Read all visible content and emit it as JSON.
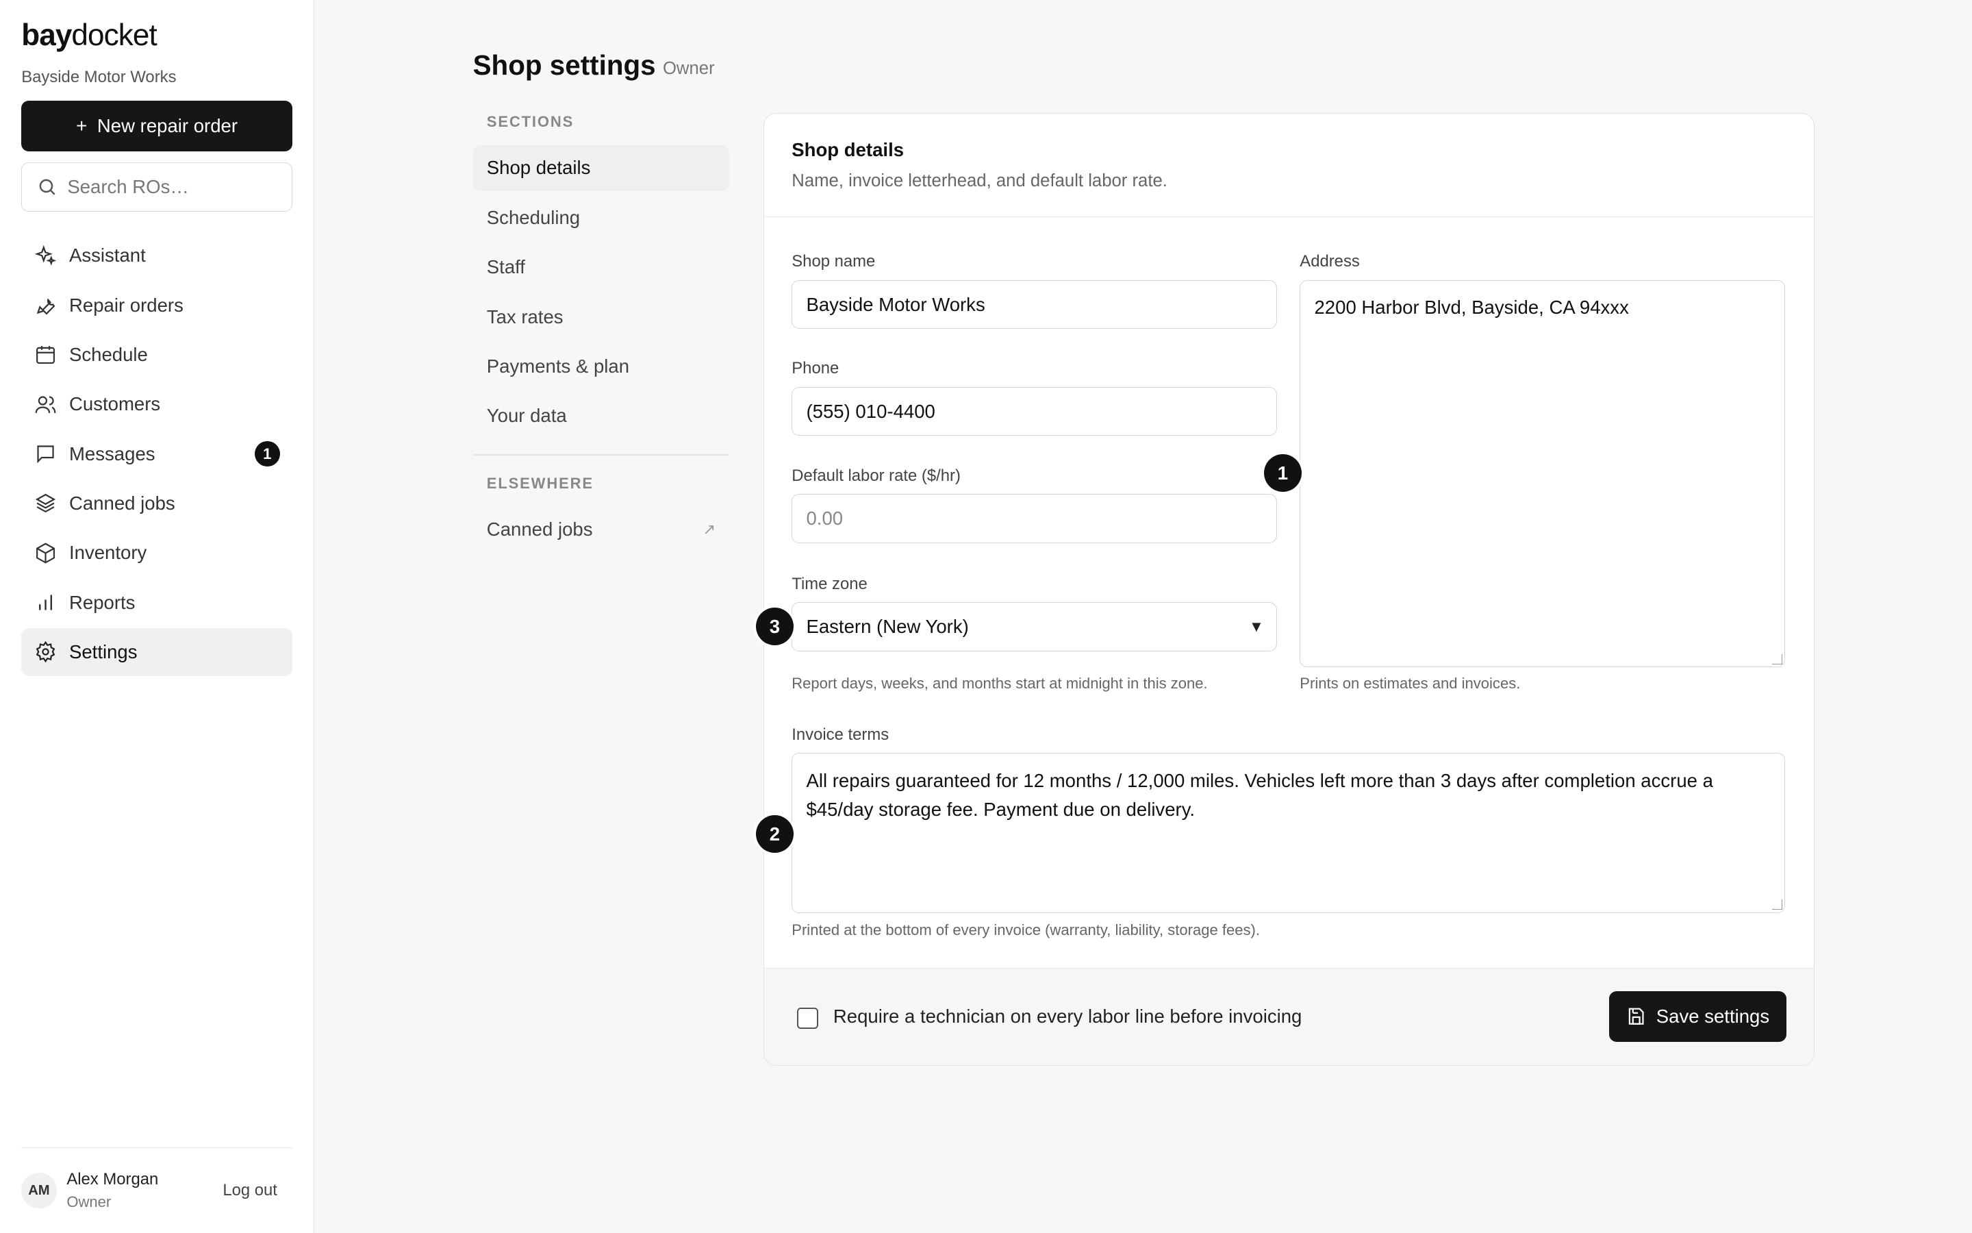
{
  "brand": {
    "bold": "bay",
    "light": "docket",
    "shop": "Bayside Motor Works"
  },
  "actions": {
    "new_ro": "New repair order",
    "new_ro_plus": "+"
  },
  "search": {
    "placeholder": "Search ROs…"
  },
  "nav": [
    {
      "label": "Assistant",
      "icon": "sparkle-icon"
    },
    {
      "label": "Repair orders",
      "icon": "wrench-icon"
    },
    {
      "label": "Schedule",
      "icon": "calendar-icon"
    },
    {
      "label": "Customers",
      "icon": "users-icon"
    },
    {
      "label": "Messages",
      "icon": "message-icon",
      "badge": "1"
    },
    {
      "label": "Canned jobs",
      "icon": "layers-icon"
    },
    {
      "label": "Inventory",
      "icon": "box-icon"
    },
    {
      "label": "Reports",
      "icon": "bar-chart-icon"
    },
    {
      "label": "Settings",
      "icon": "gear-icon",
      "active": true
    }
  ],
  "user": {
    "initials": "AM",
    "name": "Alex Morgan",
    "role": "Owner",
    "logout": "Log out"
  },
  "page": {
    "title": "Shop settings",
    "role": "Owner"
  },
  "sections": {
    "label": "SECTIONS",
    "items": [
      "Shop details",
      "Scheduling",
      "Staff",
      "Tax rates",
      "Payments & plan",
      "Your data"
    ],
    "elsewhere_label": "ELSEWHERE",
    "elsewhere_items": [
      "Canned jobs"
    ],
    "ext_icon": "↗"
  },
  "card": {
    "title": "Shop details",
    "description": "Name, invoice letterhead, and default labor rate.",
    "shop_name_label": "Shop name",
    "shop_name_value": "Bayside Motor Works",
    "address_label": "Address",
    "address_value": "2200 Harbor Blvd, Bayside, CA 94xxx",
    "address_hint": "Prints on estimates and invoices.",
    "phone_label": "Phone",
    "phone_value": "(555) 010-4400",
    "labor_label": "Default labor rate ($/hr)",
    "labor_placeholder": "0.00",
    "tz_label": "Time zone",
    "tz_value": "Eastern (New York)",
    "tz_caret": "▼",
    "tz_hint": "Report days, weeks, and months start at midnight in this zone.",
    "terms_label": "Invoice terms",
    "terms_value": "All repairs guaranteed for 12 months / 12,000 miles. Vehicles left more than 3 days after completion accrue a $45/day storage fee. Payment due on delivery.",
    "terms_hint": "Printed at the bottom of every invoice (warranty, liability, storage fees).",
    "checkbox_label": "Require a technician on every labor line before invoicing",
    "checkbox_checked": false,
    "save_label": "Save settings"
  },
  "markers": [
    "1",
    "2",
    "3"
  ]
}
